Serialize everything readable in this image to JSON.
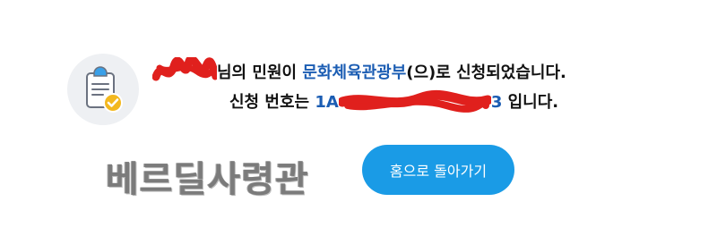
{
  "icon": {
    "name": "clipboard-check-icon",
    "circle_color": "#eef0f3",
    "check_color": "#f3b81e",
    "accent_color": "#1a9be6"
  },
  "message": {
    "line1_suffix": "님의 민원이 ",
    "department": "문화체육관광부",
    "line1_end": "(으)로 신청되었습니다.",
    "line2_prefix": "신청 번호는 ",
    "number_start": "1A",
    "number_end": "3",
    "line2_end": " 입니다."
  },
  "signature_text": "베르딜사령관",
  "home_button": {
    "label": "홈으로 돌아가기",
    "color": "#1a9be6"
  },
  "colors": {
    "text": "#111111",
    "link": "#1b5db3",
    "redaction": "#e0201d"
  }
}
